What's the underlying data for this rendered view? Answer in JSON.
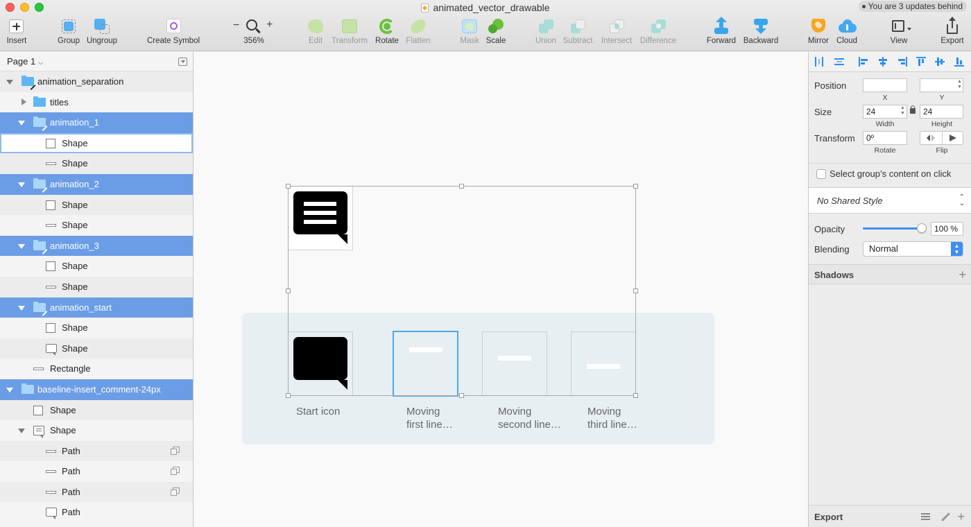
{
  "window": {
    "title": "animated_vector_drawable",
    "updates_badge": "You are 3 updates behind"
  },
  "toolbar": {
    "insert": "Insert",
    "group": "Group",
    "ungroup": "Ungroup",
    "create_symbol": "Create Symbol",
    "zoom_minus": "−",
    "zoom_plus": "+",
    "zoom_level": "356%",
    "edit": "Edit",
    "transform": "Transform",
    "rotate": "Rotate",
    "flatten": "Flatten",
    "mask": "Mask",
    "scale": "Scale",
    "union": "Union",
    "subtract": "Subtract",
    "intersect": "Intersect",
    "difference": "Difference",
    "forward": "Forward",
    "backward": "Backward",
    "mirror": "Mirror",
    "cloud": "Cloud",
    "view": "View",
    "export": "Export"
  },
  "left_panel": {
    "page": "Page 1",
    "layers": [
      {
        "label": "animation_separation"
      },
      {
        "label": "titles"
      },
      {
        "label": "animation_1"
      },
      {
        "label": "Shape"
      },
      {
        "label": "Shape"
      },
      {
        "label": "animation_2"
      },
      {
        "label": "Shape"
      },
      {
        "label": "Shape"
      },
      {
        "label": "animation_3"
      },
      {
        "label": "Shape"
      },
      {
        "label": "Shape"
      },
      {
        "label": "animation_start"
      },
      {
        "label": "Shape"
      },
      {
        "label": "Shape"
      },
      {
        "label": "Rectangle"
      },
      {
        "label": "baseline-insert_comment-24px"
      },
      {
        "label": "Shape"
      },
      {
        "label": "Shape"
      },
      {
        "label": "Path"
      },
      {
        "label": "Path"
      },
      {
        "label": "Path"
      },
      {
        "label": "Path"
      }
    ]
  },
  "canvas": {
    "captions": {
      "start": "Start icon",
      "first_1": "Moving",
      "first_2": "first line…",
      "second_1": "Moving",
      "second_2": "second line…",
      "third_1": "Moving",
      "third_2": "third line…"
    }
  },
  "inspector": {
    "position_label": "Position",
    "x_value": "",
    "y_value": "",
    "x_label": "X",
    "y_label": "Y",
    "size_label": "Size",
    "width_value": "24",
    "height_value": "24",
    "width_label": "Width",
    "height_label": "Height",
    "transform_label": "Transform",
    "rotate_value": "0º",
    "rotate_label": "Rotate",
    "flip_label": "Flip",
    "select_group_content": "Select group’s content on click",
    "shared_style": "No Shared Style",
    "opacity_label": "Opacity",
    "opacity_value": "100 %",
    "opacity_level": 1.0,
    "blending_label": "Blending",
    "blending_value": "Normal",
    "shadows_label": "Shadows",
    "export_label": "Export"
  },
  "colors": {
    "selection": "#6b9de6",
    "accent": "#2a8ef0",
    "folder": "#5eb7f2"
  }
}
